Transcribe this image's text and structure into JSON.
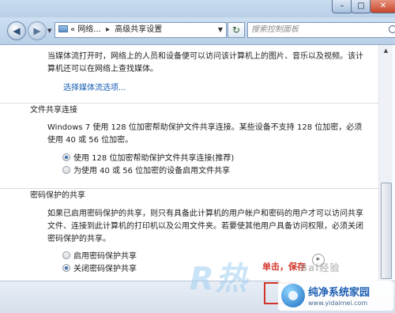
{
  "window": {
    "min_glyph": "–",
    "max_glyph": "□",
    "close_glyph": "✕"
  },
  "nav": {
    "address_parts": [
      "«",
      "网络...",
      "▸",
      "高级共享设置"
    ],
    "search_placeholder": "搜索控制面板"
  },
  "media": {
    "desc_line1": "当媒体流打开时，网络上的人员和设备便可以访问该计算机上的图片、音乐以及视频。该计",
    "desc_line2": "算机还可以在网络上查找媒体。",
    "link": "选择媒体流选项..."
  },
  "file_sharing": {
    "heading": "文件共享连接",
    "desc_line1": "Windows 7 使用 128 位加密帮助保护文件共享连接。某些设备不支持 128 位加密，必须",
    "desc_line2": "使用 40 或 56 位加密。",
    "options": [
      {
        "label": "使用 128 位加密帮助保护文件共享连接(推荐)",
        "selected": true
      },
      {
        "label": "为使用 40 或 56 位加密的设备启用文件共享",
        "selected": false
      }
    ]
  },
  "password": {
    "heading": "密码保护的共享",
    "desc_line1": "如果已启用密码保护的共享，则只有具备此计算机的用户帐户和密码的用户才可以访问共享",
    "desc_line2": "文件、连接到此计算机的打印机以及公用文件夹。若要使其他用户具备访问权限，必须关闭",
    "desc_line3": "密码保护的共享。",
    "options": [
      {
        "label": "启用密码保护共享",
        "selected": false
      },
      {
        "label": "关闭密码保护共享",
        "selected": true
      }
    ]
  },
  "annotation": {
    "text": "单击，保存",
    "watermark": "Bai经验"
  },
  "watermark_r": "R热",
  "site_badge": {
    "name": "纯净系统家园",
    "url": "www.yidaimei.com"
  }
}
